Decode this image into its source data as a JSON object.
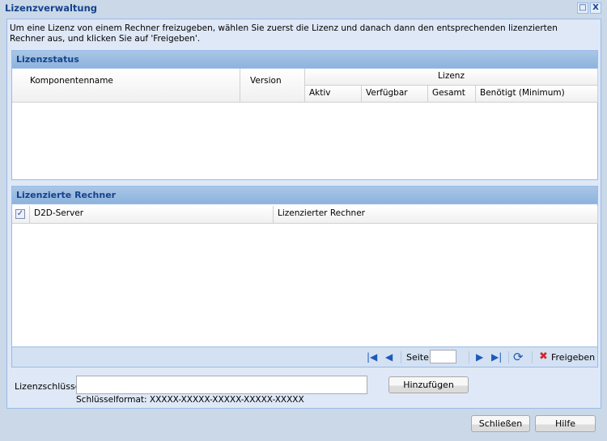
{
  "window": {
    "title": "Lizenzverwaltung",
    "maximize_icon": "□",
    "close_icon": "X"
  },
  "description": "Um eine Lizenz von einem Rechner freizugeben, wählen Sie zuerst die Lizenz und danach dann den entsprechenden lizenzierten Rechner aus, und klicken Sie auf 'Freigeben'.",
  "license_status": {
    "title": "Lizenzstatus",
    "columns": {
      "component": "Komponentenname",
      "version": "Version",
      "license": "Lizenz",
      "active": "Aktiv",
      "available": "Verfügbar",
      "total": "Gesamt",
      "required": "Benötigt (Minimum)"
    }
  },
  "licensed_machines": {
    "title": "Lizenzierte Rechner",
    "columns": {
      "server": "D2D-Server",
      "machine": "Lizenzierter Rechner"
    },
    "select_all_checked": true,
    "pager": {
      "page_label": "Seite",
      "page_value": "",
      "release_label": "Freigeben"
    }
  },
  "license_key": {
    "label": "Lizenzschlüssel",
    "value": "",
    "format_hint": "Schlüsselformat: XXXXX-XXXXX-XXXXX-XXXXX-XXXXX",
    "add_label": "Hinzufügen"
  },
  "footer": {
    "close_label": "Schließen",
    "help_label": "Hilfe"
  }
}
